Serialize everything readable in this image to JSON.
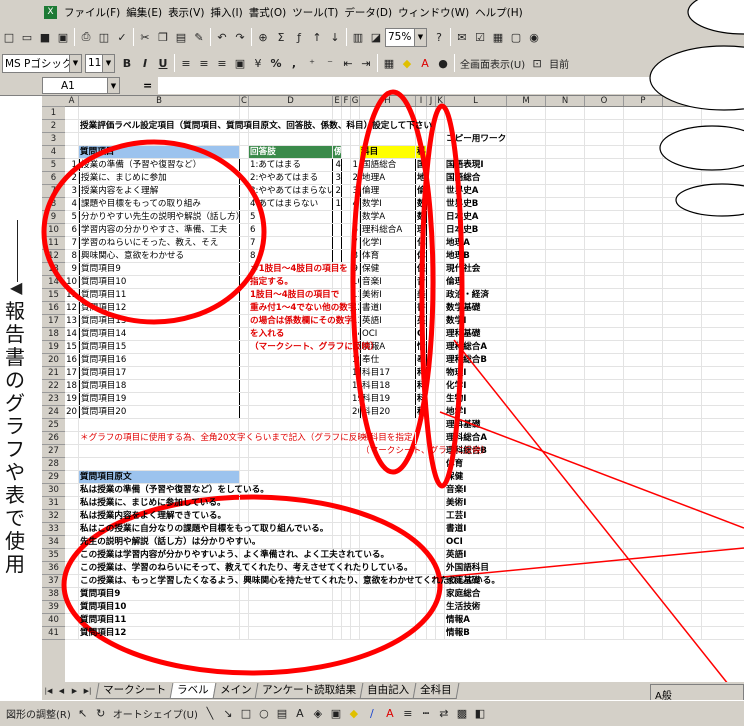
{
  "menu": [
    "ファイル(F)",
    "編集(E)",
    "表示(V)",
    "挿入(I)",
    "書式(O)",
    "ツール(T)",
    "データ(D)",
    "ウィンドウ(W)",
    "ヘルプ(H)"
  ],
  "toolbar": {
    "zoom": "75%",
    "close_label": "目前"
  },
  "format": {
    "font_name": "MS Pゴシック",
    "font_size": "11",
    "bold": "B",
    "italic": "I",
    "underline": "U",
    "percent": "%",
    "comma": ",",
    "fullscreen": "全画面表示(U)"
  },
  "formula": {
    "cell_ref": "A1",
    "eq": "="
  },
  "columns": [
    "A",
    "B",
    "C",
    "D",
    "E",
    "F",
    "G",
    "H",
    "I",
    "J",
    "K",
    "L",
    "M",
    "N",
    "O",
    "P",
    "Q"
  ],
  "rows": [
    {
      "n": "1",
      "a": "",
      "b": "",
      "d": "",
      "e": "",
      "f": "",
      "gh": "",
      "i": "",
      "l": ""
    },
    {
      "n": "2",
      "a": "",
      "b": "授業評価ラベル設定項目（質問項目、質問項目原文、回答肢、係数、科目）設定して下さい",
      "d": "",
      "e": "",
      "f": "",
      "gh": "",
      "i": "",
      "l": ""
    },
    {
      "n": "3",
      "a": "",
      "b": "",
      "d": "",
      "e": "",
      "f": "",
      "gh": "",
      "i": "",
      "l": "コピー用ワーク"
    },
    {
      "n": "4",
      "a": "",
      "b": "質問項目",
      "d": "回答肢",
      "e": "係数",
      "f": "",
      "gh": "科目",
      "i": "科",
      "l": ""
    },
    {
      "n": "5",
      "a": "1",
      "b": "授業の準備（予習や復習など）",
      "d": "1:あてはまる",
      "e": "4",
      "f": "1",
      "gh": "国語総合",
      "i": "国",
      "l": "国語表現I"
    },
    {
      "n": "6",
      "a": "2",
      "b": "授業に、まじめに参加",
      "d": "2:ややあてはまる",
      "e": "3",
      "f": "2",
      "gh": "地理A",
      "i": "地",
      "l": "国語総合"
    },
    {
      "n": "7",
      "a": "3",
      "b": "授業内容をよく理解",
      "d": "3:ややあてはまらない",
      "e": "2",
      "f": "3",
      "gh": "倫理",
      "i": "倫",
      "l": "世界史A"
    },
    {
      "n": "8",
      "a": "4",
      "b": "課題や目標をもっての取り組み",
      "d": "4:あてはまらない",
      "e": "1",
      "f": "4",
      "gh": "数学I",
      "i": "数",
      "l": "世界史B"
    },
    {
      "n": "9",
      "a": "5",
      "b": "分かりやすい先生の説明や解説（話し方）",
      "d": "5",
      "e": "",
      "f": "5",
      "gh": "数学A",
      "i": "数",
      "l": "日本史A"
    },
    {
      "n": "10",
      "a": "6",
      "b": "学習内容の分かりやすさ、準備、工夫",
      "d": "6",
      "e": "",
      "f": "6",
      "gh": "理科総合A",
      "i": "理",
      "l": "日本史B"
    },
    {
      "n": "11",
      "a": "7",
      "b": "学習のねらいにそった、教え、そえ",
      "d": "7",
      "e": "",
      "f": "7",
      "gh": "化学I",
      "i": "化",
      "l": "地理A"
    },
    {
      "n": "12",
      "a": "8",
      "b": "興味関心、意欲をわかせる",
      "d": "8",
      "e": "",
      "f": "8",
      "gh": "体育",
      "i": "体",
      "l": "地理B"
    },
    {
      "n": "13",
      "a": "9",
      "b": "質問項目9",
      "d": "＊1肢目〜4肢目の項目を",
      "e": "",
      "f": "9",
      "gh": "保健",
      "i": "保",
      "l": "現代社会"
    },
    {
      "n": "14",
      "a": "10",
      "b": "質問項目10",
      "d": "指定する。",
      "e": "",
      "f": "10",
      "gh": "音楽I",
      "i": "音",
      "l": "倫理"
    },
    {
      "n": "15",
      "a": "11",
      "b": "質問項目11",
      "d": "1肢目〜4肢目の項目で",
      "e": "",
      "f": "11",
      "gh": "美術I",
      "i": "美",
      "l": "政治・経済"
    },
    {
      "n": "16",
      "a": "12",
      "b": "質問項目12",
      "d": "重み付1〜4でない他の数字",
      "e": "",
      "f": "12",
      "gh": "書道I",
      "i": "書",
      "l": "数学基礎"
    },
    {
      "n": "17",
      "a": "13",
      "b": "質問項目13",
      "d": "の場合は係数欄にその数字",
      "e": "",
      "f": "13",
      "gh": "英語I",
      "i": "英",
      "l": "数学I"
    },
    {
      "n": "18",
      "a": "14",
      "b": "質問項目14",
      "d": "を入れる",
      "e": "",
      "f": "14",
      "gh": "OCI",
      "i": "O",
      "l": "理科基礎"
    },
    {
      "n": "19",
      "a": "15",
      "b": "質問項目15",
      "d": "（マークシート、グラフに反映）",
      "e": "",
      "f": "15",
      "gh": "情報A",
      "i": "情",
      "l": "理科総合A"
    },
    {
      "n": "20",
      "a": "16",
      "b": "質問項目16",
      "d": "",
      "e": "",
      "f": "16",
      "gh": "奉仕",
      "i": "奉",
      "l": "理科総合B"
    },
    {
      "n": "21",
      "a": "17",
      "b": "質問項目17",
      "d": "",
      "e": "",
      "f": "17",
      "gh": "科目17",
      "i": "科",
      "l": "物理I"
    },
    {
      "n": "22",
      "a": "18",
      "b": "質問項目18",
      "d": "",
      "e": "",
      "f": "18",
      "gh": "科目18",
      "i": "科",
      "l": "化学I"
    },
    {
      "n": "23",
      "a": "19",
      "b": "質問項目19",
      "d": "",
      "e": "",
      "f": "19",
      "gh": "科目19",
      "i": "科",
      "l": "生物I"
    },
    {
      "n": "24",
      "a": "20",
      "b": "質問項目20",
      "d": "",
      "e": "",
      "f": "20",
      "gh": "科目20",
      "i": "科",
      "l": "地学I"
    },
    {
      "n": "25",
      "a": "",
      "b": "",
      "d": "",
      "e": "",
      "f": "",
      "gh": "",
      "i": "",
      "l": "理科基礎"
    },
    {
      "n": "26",
      "a": "",
      "b": "＊グラフの項目に使用する為、全角20文字くらいまで記入（グラフに反映）",
      "d": "",
      "e": "",
      "f": "",
      "gh": "＊科目を指定",
      "i": "",
      "l": "理科総合A"
    },
    {
      "n": "27",
      "a": "",
      "b": "",
      "d": "",
      "e": "",
      "f": "",
      "gh": "（マークシート、グラフに反映）",
      "i": "",
      "l": "理科総合B"
    },
    {
      "n": "28",
      "a": "",
      "b": "",
      "d": "",
      "e": "",
      "f": "",
      "gh": "",
      "i": "",
      "l": "体育"
    },
    {
      "n": "29",
      "a": "",
      "b": "質問項目原文",
      "d": "",
      "e": "",
      "f": "",
      "gh": "",
      "i": "",
      "l": "保健"
    },
    {
      "n": "30",
      "a": "",
      "b": "私は授業の準備（予習や復習など）をしている。",
      "d": "",
      "e": "",
      "f": "",
      "gh": "",
      "i": "",
      "l": "音楽I"
    },
    {
      "n": "31",
      "a": "",
      "b": "私は授業に、まじめに参加している。",
      "d": "",
      "e": "",
      "f": "",
      "gh": "",
      "i": "",
      "l": "美術I"
    },
    {
      "n": "32",
      "a": "",
      "b": "私は授業内容をよく理解できている。",
      "d": "",
      "e": "",
      "f": "",
      "gh": "",
      "i": "",
      "l": "工芸I"
    },
    {
      "n": "33",
      "a": "",
      "b": "私はこの授業に自分なりの課題や目標をもって取り組んでいる。",
      "d": "",
      "e": "",
      "f": "",
      "gh": "",
      "i": "",
      "l": "書道I"
    },
    {
      "n": "34",
      "a": "",
      "b": "先生の説明や解説（話し方）は分かりやすい。",
      "d": "",
      "e": "",
      "f": "",
      "gh": "",
      "i": "",
      "l": "OCI"
    },
    {
      "n": "35",
      "a": "",
      "b": "この授業は学習内容が分かりやすいよう、よく準備され、よく工夫されている。",
      "d": "",
      "e": "",
      "f": "",
      "gh": "",
      "i": "",
      "l": "英語I"
    },
    {
      "n": "36",
      "a": "",
      "b": "この授業は、学習のねらいにそって、教えてくれたり、考えさせてくれたりしている。",
      "d": "",
      "e": "",
      "f": "",
      "gh": "",
      "i": "",
      "l": "外国語科目"
    },
    {
      "n": "37",
      "a": "",
      "b": "この授業は、もっと学習したくなるよう、興味関心を持たせてくれたり、意欲をわかせてくれたりしている。",
      "d": "",
      "e": "",
      "f": "",
      "gh": "",
      "i": "",
      "l": "家庭基礎"
    },
    {
      "n": "38",
      "a": "",
      "b": "質問項目9",
      "d": "",
      "e": "",
      "f": "",
      "gh": "",
      "i": "",
      "l": "家庭総合"
    },
    {
      "n": "39",
      "a": "",
      "b": "質問項目10",
      "d": "",
      "e": "",
      "f": "",
      "gh": "",
      "i": "",
      "l": "生活技術"
    },
    {
      "n": "40",
      "a": "",
      "b": "質問項目11",
      "d": "",
      "e": "",
      "f": "",
      "gh": "",
      "i": "",
      "l": "情報A"
    },
    {
      "n": "41",
      "a": "",
      "b": "質問項目12",
      "d": "",
      "e": "",
      "f": "",
      "gh": "",
      "i": "",
      "l": "情報B"
    }
  ],
  "side_label": "報告書のグラフや表で使用",
  "sheet_tabs": [
    "マークシート",
    "ラベル",
    "メイン",
    "アンケート読取結果",
    "自由記入",
    "全科目"
  ],
  "drawbar": {
    "adjust": "図形の調整(R)",
    "autoshape": "オートシェイプ(U)"
  },
  "ime": "A般",
  "colors": {
    "header_blue": "#9cc3ee",
    "header_green": "#3a8a4a",
    "header_yellow": "#ffff00",
    "annotation": "#ff0000",
    "note_red": "#e00000"
  }
}
